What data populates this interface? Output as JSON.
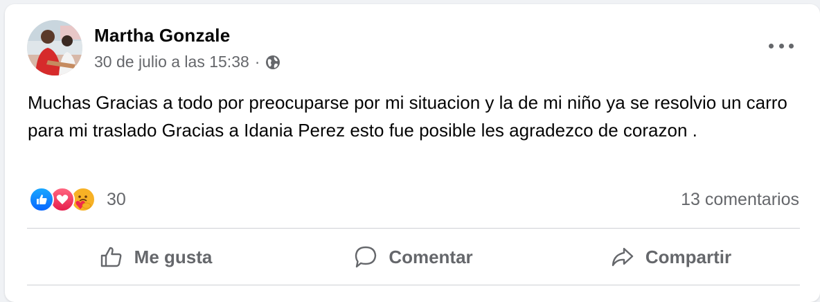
{
  "post": {
    "author": "Martha Gonzale",
    "timestamp": "30 de julio a las 15:38",
    "separator": "·",
    "privacy_icon": "globe-icon",
    "text": "Muchas Gracias a todo por preocuparse por mi situacion y la de mi niño ya se resolvio un carro para mi traslado Gracias a Idania Perez esto fue posible les agradezco de corazon ."
  },
  "reactions": {
    "icons": [
      "like-icon",
      "love-icon",
      "care-icon"
    ],
    "count": "30"
  },
  "comments": {
    "label": "13 comentarios"
  },
  "actions": {
    "like_label": "Me gusta",
    "comment_label": "Comentar",
    "share_label": "Compartir"
  },
  "colors": {
    "secondary_text": "#65676b",
    "primary_text": "#050505",
    "like_blue": "#0866ff",
    "love_red": "#e61e4d",
    "care_yellow": "#f7b125"
  }
}
